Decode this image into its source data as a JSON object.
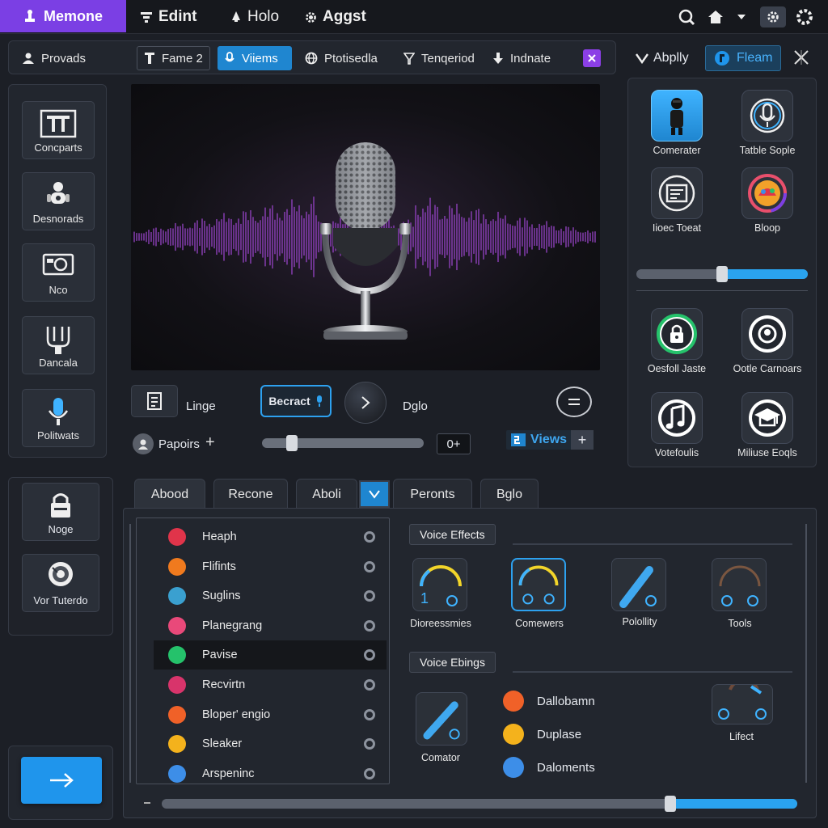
{
  "topbar": {
    "brand": "Memone",
    "menus": [
      "Edint",
      "Holo",
      "Aggst"
    ]
  },
  "toolbar": {
    "items": [
      {
        "label": "Provads"
      },
      {
        "label": "Fame 2"
      },
      {
        "label": "Viiems"
      },
      {
        "label": "Ptotisedla"
      },
      {
        "label": "Tenqeriod"
      },
      {
        "label": "Indnate"
      }
    ]
  },
  "right_tabs": {
    "apply": "Abplly",
    "fleam": "Fleam"
  },
  "left_tools": [
    {
      "label": "Concparts",
      "icon": "text-frame-icon"
    },
    {
      "label": "Desnorads",
      "icon": "robot-icon"
    },
    {
      "label": "Nco",
      "icon": "camera-icon"
    },
    {
      "label": "Dancala",
      "icon": "grip-icon"
    },
    {
      "label": "Politwats",
      "icon": "microphone-icon"
    }
  ],
  "transport": {
    "linge": "Linge",
    "record_button": "Becract",
    "dglo": "Dglo",
    "papoirs": "Papoirs",
    "counter": "0+",
    "views": "Views"
  },
  "right_panel": {
    "tiles_top": [
      {
        "label": "Comerater",
        "icon": "person-icon"
      },
      {
        "label": "Tatble Sople",
        "icon": "microphone-icon"
      },
      {
        "label": "Iioec Toeat",
        "icon": "document-icon"
      },
      {
        "label": "Bloop",
        "icon": "colorful-badge-icon"
      }
    ],
    "slider_level": 0.5,
    "tiles_bottom": [
      {
        "label": "Oesfoll Jaste",
        "icon": "lock-icon"
      },
      {
        "label": "Ootle Carnoars",
        "icon": "target-icon"
      },
      {
        "label": "Votefoulis",
        "icon": "music-note-icon"
      },
      {
        "label": "Miliuse Eoqls",
        "icon": "graduation-cap-icon"
      }
    ]
  },
  "lower_left": [
    {
      "label": "Noge",
      "icon": "lock-icon"
    },
    {
      "label": "Vor Tuterdo",
      "icon": "camera-lens-icon"
    }
  ],
  "bottom_tabs": [
    "Abood",
    "Recone",
    "Aboli",
    "Peronts",
    "Bglo"
  ],
  "list_items": [
    {
      "label": "Heaph",
      "color": "#e0344a"
    },
    {
      "label": "Flifints",
      "color": "#f07a1e"
    },
    {
      "label": "Suglins",
      "color": "#3aa0d0"
    },
    {
      "label": "Planegrang",
      "color": "#e9497a"
    },
    {
      "label": "Pavise",
      "color": "#25c26b",
      "selected": true
    },
    {
      "label": "Recvirtn",
      "color": "#d8346b"
    },
    {
      "label": "Bloper' engio",
      "color": "#f06128"
    },
    {
      "label": "Sleaker",
      "color": "#f4b21c"
    },
    {
      "label": "Arspeninc",
      "color": "#3d8ee8"
    }
  ],
  "voice_effects": {
    "title": "Voice Effects",
    "knobs": [
      {
        "label": "Dioreessmies",
        "value": "1"
      },
      {
        "label": "Comewers"
      },
      {
        "label": "Polollity"
      },
      {
        "label": "Tools"
      }
    ]
  },
  "voice_ebings": {
    "title": "Voice Ebings",
    "knob_label": "Comator",
    "options": [
      {
        "label": "Dallobamn",
        "color": "#f06128"
      },
      {
        "label": "Duplase",
        "color": "#f4b21c"
      },
      {
        "label": "Daloments",
        "color": "#3d8ee8"
      }
    ],
    "lifect": "Lifect"
  },
  "bottom_slider_level": 0.8,
  "colors": {
    "accent_purple": "#7b3fe4",
    "accent_blue": "#1f86d0",
    "background": "#1c1f26"
  }
}
